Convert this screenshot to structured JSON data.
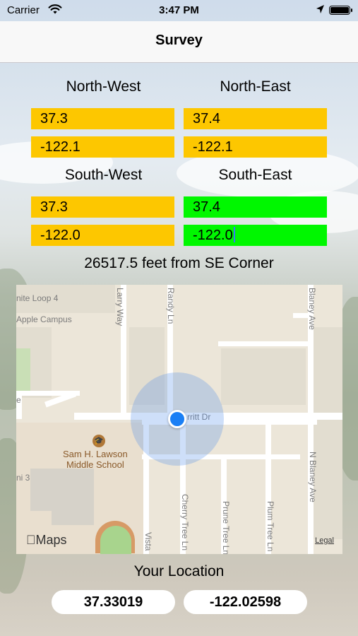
{
  "status_bar": {
    "carrier": "Carrier",
    "time": "3:47 PM"
  },
  "nav": {
    "title": "Survey"
  },
  "corners": {
    "north_west": {
      "label": "North-West",
      "lat": "37.3",
      "lon": "-122.1",
      "color": "#fdc700"
    },
    "north_east": {
      "label": "North-East",
      "lat": "37.4",
      "lon": "-122.1",
      "color": "#fdc700"
    },
    "south_west": {
      "label": "South-West",
      "lat": "37.3",
      "lon": "-122.0",
      "color": "#fdc700"
    },
    "south_east": {
      "label": "South-East",
      "lat": "37.4",
      "lon": "-122.0",
      "color": "#00f700"
    }
  },
  "distance_text": "26517.5 feet from SE Corner",
  "map": {
    "labels": {
      "infinite_loop": "nite Loop 4",
      "apple_campus": "Apple Campus",
      "larry_way": "Larry Way",
      "randy_ln": "Randy Ln",
      "blaney_ave": "Blaney Ave",
      "merritt_dr": "rritt Dr",
      "school_line1": "Sam H. Lawson",
      "school_line2": "Middle School",
      "n_blaney_ave": "N Blaney Ave",
      "cherry_tree_ln": "Cherry Tree Ln",
      "prune_tree_ln": "Prune Tree Ln",
      "plum_tree_ln": "Plum Tree Ln",
      "vista": "Vista",
      "ni3": "ni 3",
      "edge_e": "e"
    },
    "brand": "Maps",
    "legal": "Legal"
  },
  "your_location": {
    "label": "Your Location",
    "lat": "37.33019",
    "lon": "-122.02598"
  }
}
